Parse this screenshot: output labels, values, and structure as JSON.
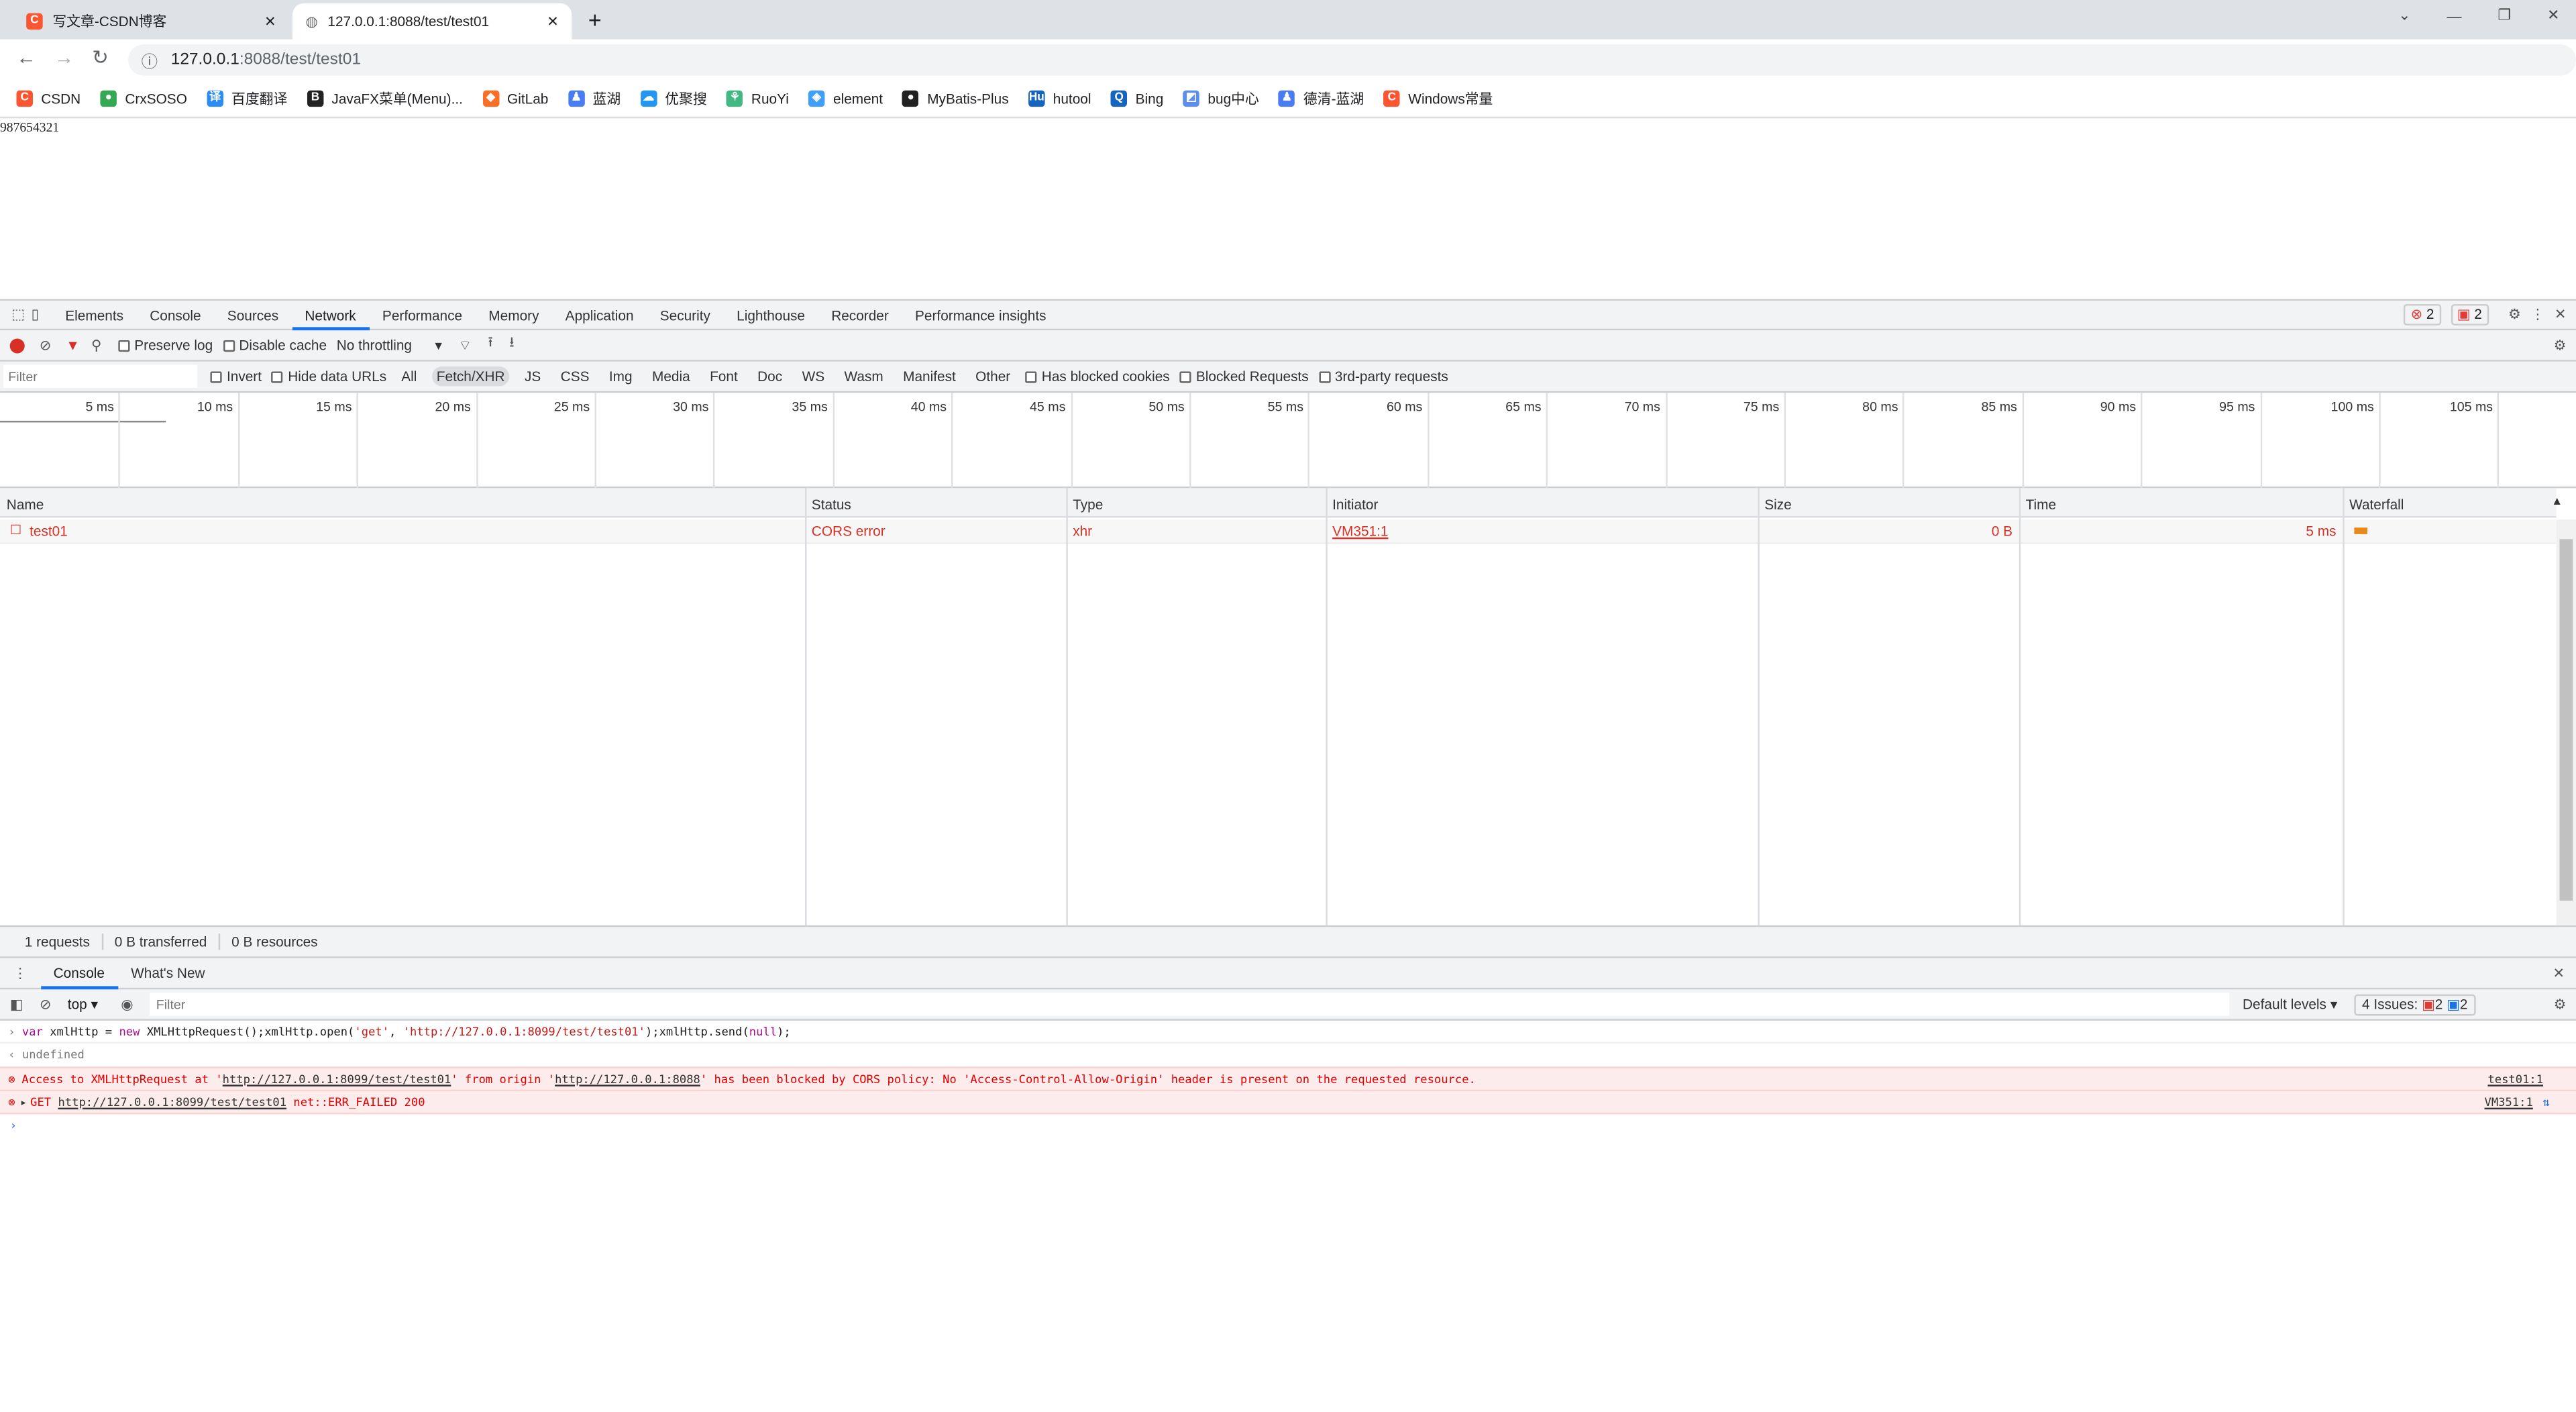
{
  "browser": {
    "tabs": [
      {
        "title": "写文章-CSDN博客",
        "active": false
      },
      {
        "title": "127.0.0.1:8088/test/test01",
        "active": true
      }
    ],
    "url_host": "127.0.0.1",
    "url_rest": ":8088/test/test01",
    "bookmarks": [
      {
        "label": "CSDN",
        "color": "#fc5531",
        "glyph": "C"
      },
      {
        "label": "CrxSOSO",
        "color": "#34a853",
        "glyph": "●"
      },
      {
        "label": "百度翻译",
        "color": "#2b8cf7",
        "glyph": "译"
      },
      {
        "label": "JavaFX菜单(Menu)...",
        "color": "#222222",
        "glyph": "B"
      },
      {
        "label": "GitLab",
        "color": "#fc6d26",
        "glyph": "◆"
      },
      {
        "label": "蓝湖",
        "color": "#4a7cf3",
        "glyph": "♟"
      },
      {
        "label": "优聚搜",
        "color": "#2196f3",
        "glyph": "☁"
      },
      {
        "label": "RuoYi",
        "color": "#42b983",
        "glyph": "⚘"
      },
      {
        "label": "element",
        "color": "#409eff",
        "glyph": "◈"
      },
      {
        "label": "MyBatis-Plus",
        "color": "#222222",
        "glyph": "●"
      },
      {
        "label": "hutool",
        "color": "#1565c0",
        "glyph": "Hu"
      },
      {
        "label": "Bing",
        "color": "#1565c0",
        "glyph": "Q"
      },
      {
        "label": "bug中心",
        "color": "#5b8def",
        "glyph": "◩"
      },
      {
        "label": "德清-蓝湖",
        "color": "#4a7cf3",
        "glyph": "♟"
      },
      {
        "label": "Windows常量",
        "color": "#fc5531",
        "glyph": "C"
      }
    ]
  },
  "page": {
    "text": "987654321"
  },
  "devtools": {
    "tabs": [
      "Elements",
      "Console",
      "Sources",
      "Network",
      "Performance",
      "Memory",
      "Application",
      "Security",
      "Lighthouse",
      "Recorder",
      "Performance insights"
    ],
    "active_tab": "Network",
    "errors_count": "2",
    "issues_count": "2",
    "toolbar": {
      "preserve_log": "Preserve log",
      "disable_cache": "Disable cache",
      "throttling": "No throttling"
    },
    "filter": {
      "placeholder": "Filter",
      "invert": "Invert",
      "hide_data_urls": "Hide data URLs",
      "types": [
        "All",
        "Fetch/XHR",
        "JS",
        "CSS",
        "Img",
        "Media",
        "Font",
        "Doc",
        "WS",
        "Wasm",
        "Manifest",
        "Other"
      ],
      "active_type": "Fetch/XHR",
      "has_blocked_cookies": "Has blocked cookies",
      "blocked_requests": "Blocked Requests",
      "third_party": "3rd-party requests"
    },
    "timeline_ticks": [
      "5 ms",
      "10 ms",
      "15 ms",
      "20 ms",
      "25 ms",
      "30 ms",
      "35 ms",
      "40 ms",
      "45 ms",
      "50 ms",
      "55 ms",
      "60 ms",
      "65 ms",
      "70 ms",
      "75 ms",
      "80 ms",
      "85 ms",
      "90 ms",
      "95 ms",
      "100 ms",
      "105 ms"
    ],
    "columns": [
      "Name",
      "Status",
      "Type",
      "Initiator",
      "Size",
      "Time",
      "Waterfall"
    ],
    "requests": [
      {
        "name": "test01",
        "status": "CORS error",
        "type": "xhr",
        "initiator": "VM351:1",
        "size": "0 B",
        "time": "5 ms"
      }
    ],
    "summary": [
      "1 requests",
      "0 B transferred",
      "0 B resources"
    ],
    "drawer": {
      "tabs": [
        "Console",
        "What's New"
      ],
      "context": "top",
      "filter_placeholder": "Filter",
      "levels": "Default levels",
      "issues_label": "4 Issues:",
      "issues_errors": "2",
      "issues_info": "2",
      "messages": {
        "input": {
          "kw1": "var",
          "a": " xmlHttp = ",
          "kw2": "new",
          "b": " XMLHttpRequest();xmlHttp.open(",
          "s1": "'get'",
          "c": ", ",
          "s2": "'http://127.0.0.1:8099/test/test01'",
          "d": ");xmlHttp.send(",
          "n": "null",
          "e": ");"
        },
        "result": "undefined",
        "error1": {
          "p1": "Access to XMLHttpRequest at '",
          "url1": "http://127.0.0.1:8099/test/test01",
          "p2": "' from origin '",
          "url2": "http://127.0.0.1:8088",
          "p3": "' has been blocked by CORS policy: No 'Access-Control-Allow-Origin' header is present on the requested resource.",
          "source": "test01:1"
        },
        "error2": {
          "method": "GET",
          "url": "http://127.0.0.1:8099/test/test01",
          "msg": "net::ERR_FAILED 200",
          "source": "VM351:1"
        }
      }
    }
  }
}
